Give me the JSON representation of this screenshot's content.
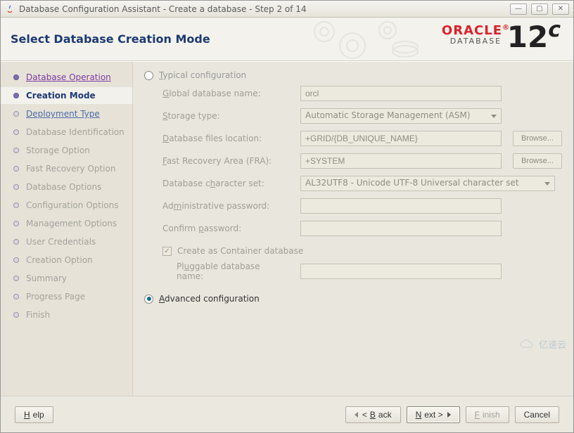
{
  "window": {
    "title": "Database Configuration Assistant - Create a database - Step 2 of 14"
  },
  "header": {
    "heading": "Select Database Creation Mode",
    "brand_top": "ORACLE",
    "brand_bottom": "DATABASE",
    "brand_version": "12",
    "brand_version_suffix": "c"
  },
  "nav": {
    "items": [
      {
        "label": "Database Operation",
        "state": "visited"
      },
      {
        "label": "Creation Mode",
        "state": "active"
      },
      {
        "label": "Deployment Type",
        "state": "upcoming"
      },
      {
        "label": "Database Identification",
        "state": "disabled"
      },
      {
        "label": "Storage Option",
        "state": "disabled"
      },
      {
        "label": "Fast Recovery Option",
        "state": "disabled"
      },
      {
        "label": "Database Options",
        "state": "disabled"
      },
      {
        "label": "Configuration Options",
        "state": "disabled"
      },
      {
        "label": "Management Options",
        "state": "disabled"
      },
      {
        "label": "User Credentials",
        "state": "disabled"
      },
      {
        "label": "Creation Option",
        "state": "disabled"
      },
      {
        "label": "Summary",
        "state": "disabled"
      },
      {
        "label": "Progress Page",
        "state": "disabled"
      },
      {
        "label": "Finish",
        "state": "disabled"
      }
    ]
  },
  "main": {
    "typical_label": "Typical configuration",
    "advanced_label": "Advanced configuration",
    "selected_mode": "advanced",
    "fields": {
      "global_db_name": {
        "label": "Global database name:",
        "value": "orcl"
      },
      "storage_type": {
        "label": "Storage type:",
        "value": "Automatic Storage Management (ASM)"
      },
      "db_files_location": {
        "label": "Database files location:",
        "value": "+GRID/{DB_UNIQUE_NAME}"
      },
      "fra": {
        "label": "Fast Recovery Area (FRA):",
        "value": "+SYSTEM"
      },
      "charset": {
        "label": "Database character set:",
        "value": "AL32UTF8 - Unicode UTF-8 Universal character set"
      },
      "admin_pw": {
        "label": "Administrative password:",
        "value": ""
      },
      "confirm_pw": {
        "label": "Confirm password:",
        "value": ""
      }
    },
    "browse_label": "Browse...",
    "container_checkbox_label": "Create as Container database",
    "container_checked": true,
    "pluggable_label": "Pluggable database name:",
    "pluggable_value": ""
  },
  "footer": {
    "help": "Help",
    "back": "< Back",
    "next": "Next >",
    "finish": "Finish",
    "cancel": "Cancel"
  },
  "watermark": "亿速云"
}
